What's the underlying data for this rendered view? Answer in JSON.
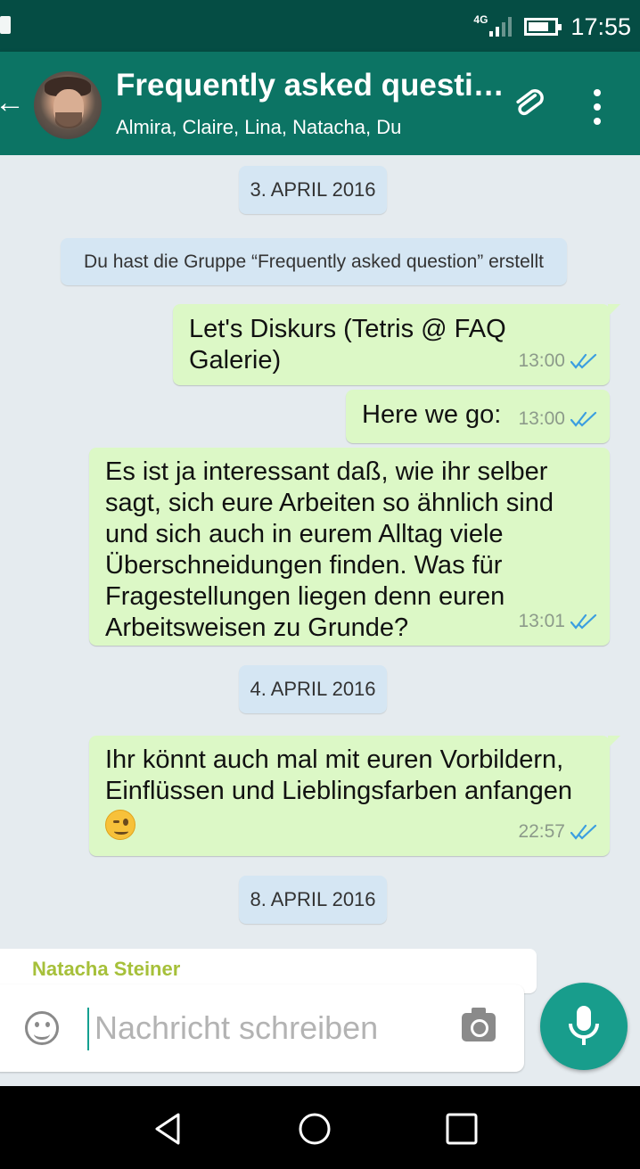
{
  "status_bar": {
    "network": "4G",
    "time": "17:55"
  },
  "header": {
    "title": "Frequently asked questi…",
    "members": "Almira, Claire, Lina, Natacha, Du"
  },
  "conversation": {
    "dates": [
      "3. APRIL 2016",
      "4. APRIL 2016",
      "8. APRIL 2016"
    ],
    "system_message": "Du hast die Gruppe “Frequently asked question” erstellt",
    "messages": [
      {
        "text": "Let's  Diskurs (Tetris @ FAQ Galerie)",
        "time": "13:00",
        "status": "read"
      },
      {
        "text": "Here we go:",
        "time": "13:00",
        "status": "read"
      },
      {
        "lines": [
          "Es ist ja interessant daß, wie ihr selber",
          "sagt, sich eure Arbeiten so ähnlich sind",
          "und sich auch in eurem Alltag viele",
          "Überschneidungen finden. Was für",
          "Fragestellungen liegen denn euren",
          "Arbeitsweisen zu Grunde?"
        ],
        "time": "13:01",
        "status": "read"
      },
      {
        "lines": [
          "Ihr könnt auch mal mit euren Vorbildern,",
          "Einflüssen und Lieblingsfarben anfangen"
        ],
        "emoji": "winking-face",
        "time": "22:57",
        "status": "read"
      }
    ],
    "incoming_sender": "Natacha Steiner"
  },
  "composer": {
    "placeholder": "Nachricht schreiben"
  },
  "colors": {
    "status_bar": "#054d44",
    "app_bar": "#0c7464",
    "outgoing_bubble": "#dcf8c6",
    "date_pill": "#d5e6f3",
    "sender_name": "#a6c03a",
    "read_ticks": "#3b9ee0",
    "fab": "#189d8c"
  }
}
